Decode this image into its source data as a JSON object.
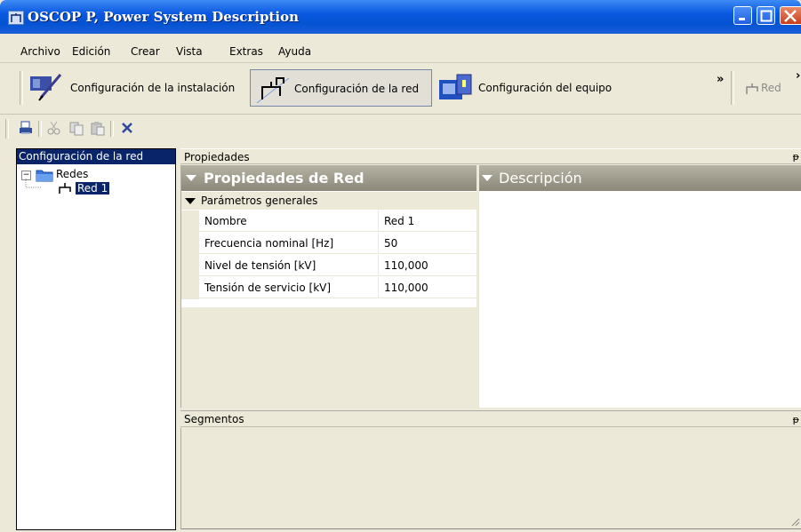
{
  "window": {
    "title": "OSCOP P, Power System Description",
    "icon": "network-icon"
  },
  "menu": [
    "Archivo",
    "Edición",
    "Crear",
    "Vista",
    "Extras",
    "Ayuda"
  ],
  "toolbar": {
    "installation_label": "Configuración de la instalación",
    "network_label": "Configuración de la red",
    "equipment_label": "Configuración del equipo",
    "overflow": "»",
    "red_label": "Red",
    "more": "›"
  },
  "toolbar2": {
    "icons": [
      "print-icon",
      "cut-icon",
      "copy-icon",
      "paste-icon",
      "delete-icon"
    ]
  },
  "tree": {
    "header": "Configuración de la red",
    "expander": "−",
    "root_label": "Redes",
    "child_label": "Red 1"
  },
  "properties": {
    "panel_title": "Propiedades",
    "pin": "ᵽ",
    "section_title": "Propiedades de Red",
    "description_title": "Descripción",
    "group_title": "Parámetros generales",
    "rows": [
      {
        "key": "Nombre",
        "value": "Red 1"
      },
      {
        "key": "Frecuencia nominal [Hz]",
        "value": "50"
      },
      {
        "key": "Nivel de tensión [kV]",
        "value": "110,000"
      },
      {
        "key": "Tensión de servicio [kV]",
        "value": "110,000"
      }
    ]
  },
  "segments": {
    "panel_title": "Segmentos",
    "pin": "ᵽ"
  },
  "colors": {
    "titlebar": "#0453d3",
    "selection": "#0a246a",
    "section_header": "#9c9888",
    "chrome": "#ece9d8"
  }
}
